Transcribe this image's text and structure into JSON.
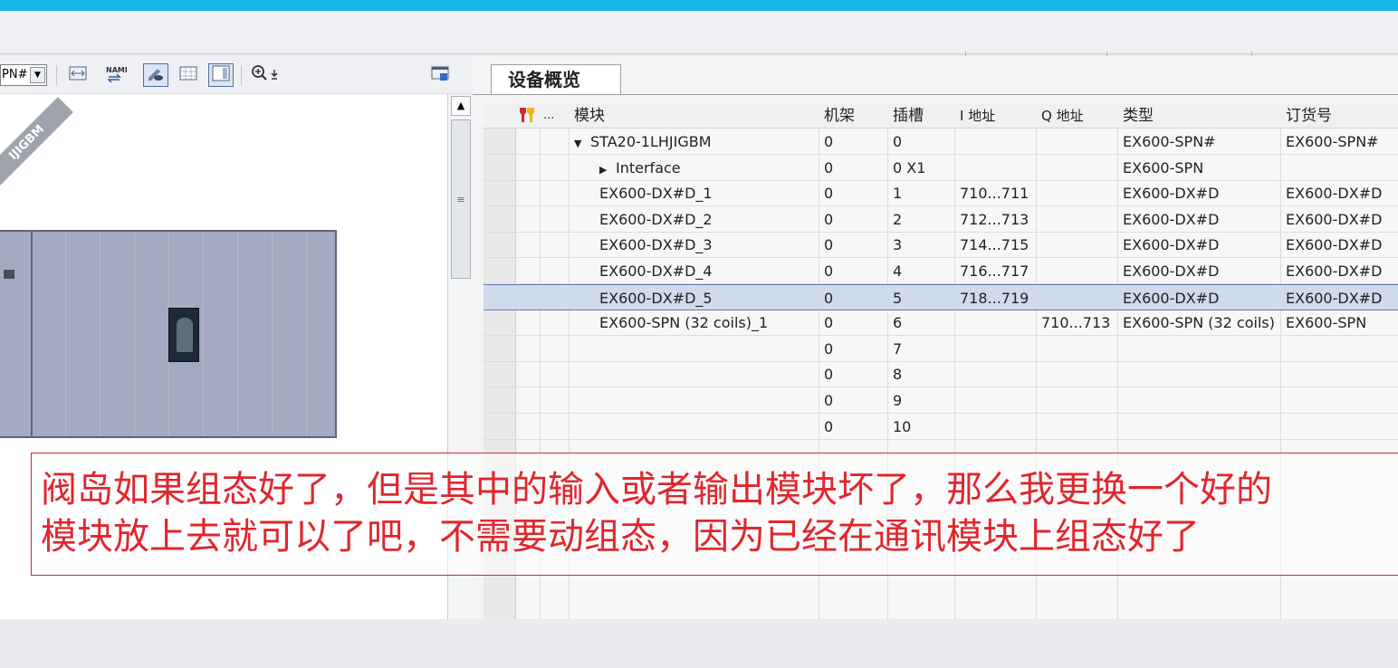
{
  "left_toolbar": {
    "combo_value": "PN#",
    "buttons": [
      "network-view-icon",
      "name-icon",
      "address-icon",
      "grid-icon",
      "panel-icon",
      "zoom-icon"
    ],
    "name_label": "NAME"
  },
  "device": {
    "diag_label": "IJIGBM"
  },
  "tab": {
    "label": "设备概览"
  },
  "table": {
    "headers": {
      "ellipsis": "...",
      "module": "模块",
      "rack": "机架",
      "slot": "插槽",
      "i_addr": "I 地址",
      "q_addr": "Q 地址",
      "type": "类型",
      "order": "订货号"
    },
    "rows": [
      {
        "module": "STA20-1LHJIGBM",
        "rack": "0",
        "slot": "0",
        "i": "",
        "q": "",
        "type": "EX600-SPN#",
        "order": "EX600-SPN#",
        "expander": "down"
      },
      {
        "module": "Interface",
        "rack": "0",
        "slot": "0 X1",
        "i": "",
        "q": "",
        "type": "EX600-SPN",
        "order": "",
        "expander": "right"
      },
      {
        "module": "EX600-DX#D_1",
        "rack": "0",
        "slot": "1",
        "i": "710...711",
        "q": "",
        "type": "EX600-DX#D",
        "order": "EX600-DX#D"
      },
      {
        "module": "EX600-DX#D_2",
        "rack": "0",
        "slot": "2",
        "i": "712...713",
        "q": "",
        "type": "EX600-DX#D",
        "order": "EX600-DX#D"
      },
      {
        "module": "EX600-DX#D_3",
        "rack": "0",
        "slot": "3",
        "i": "714...715",
        "q": "",
        "type": "EX600-DX#D",
        "order": "EX600-DX#D"
      },
      {
        "module": "EX600-DX#D_4",
        "rack": "0",
        "slot": "4",
        "i": "716...717",
        "q": "",
        "type": "EX600-DX#D",
        "order": "EX600-DX#D"
      },
      {
        "module": "EX600-DX#D_5",
        "rack": "0",
        "slot": "5",
        "i": "718...719",
        "q": "",
        "type": "EX600-DX#D",
        "order": "EX600-DX#D",
        "selected": true
      },
      {
        "module": "EX600-SPN (32 coils)_1",
        "rack": "0",
        "slot": "6",
        "i": "",
        "q": "710...713",
        "type": "EX600-SPN (32 coils)",
        "order": "EX600-SPN"
      },
      {
        "module": "",
        "rack": "0",
        "slot": "7",
        "i": "",
        "q": "",
        "type": "",
        "order": ""
      },
      {
        "module": "",
        "rack": "0",
        "slot": "8",
        "i": "",
        "q": "",
        "type": "",
        "order": ""
      },
      {
        "module": "",
        "rack": "0",
        "slot": "9",
        "i": "",
        "q": "",
        "type": "",
        "order": ""
      },
      {
        "module": "",
        "rack": "0",
        "slot": "10",
        "i": "",
        "q": "",
        "type": "",
        "order": ""
      }
    ]
  },
  "annotation": {
    "line1": "阀岛如果组态好了，但是其中的输入或者输出模块坏了，那么我更换一个好的",
    "line2": "模块放上去就可以了吧，不需要动组态，因为已经在通讯模块上组态好了"
  },
  "colors": {
    "accent_bar": "#17b6ea",
    "annotation": "#e0262d",
    "selection": "#cfdaeb"
  }
}
